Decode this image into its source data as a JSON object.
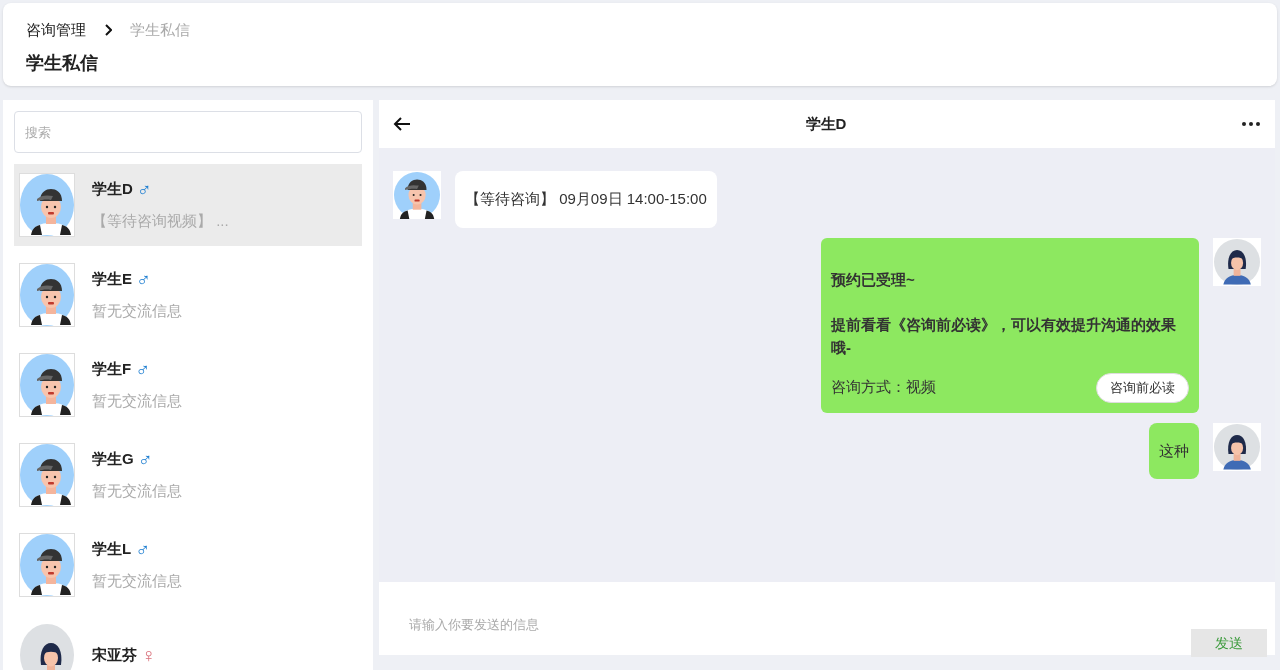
{
  "breadcrumb": [
    {
      "label": "咨询管理",
      "current": false
    },
    {
      "label": "学生私信",
      "current": true
    }
  ],
  "page_title": "学生私信",
  "search": {
    "placeholder": "搜索"
  },
  "contacts": [
    {
      "name": "学生D",
      "kind": "male",
      "symbol": "♂",
      "preview": "【等待咨询视频】 ...",
      "selected": true
    },
    {
      "name": "学生E",
      "kind": "male",
      "symbol": "♂",
      "preview": "暂无交流信息",
      "selected": false
    },
    {
      "name": "学生F",
      "kind": "male",
      "symbol": "♂",
      "preview": "暂无交流信息",
      "selected": false
    },
    {
      "name": "学生G",
      "kind": "male",
      "symbol": "♂",
      "preview": "暂无交流信息",
      "selected": false
    },
    {
      "name": "学生L",
      "kind": "male",
      "symbol": "♂",
      "preview": "暂无交流信息",
      "selected": false
    },
    {
      "name": "宋亚芬",
      "kind": "female",
      "symbol": "♀",
      "selected": false
    }
  ],
  "chat": {
    "title": "学生D",
    "messages": [
      {
        "kind": "incoming_text",
        "text": "【等待咨询】 09月09日 14:00-15:00"
      },
      {
        "kind": "outgoing_card",
        "lines": [
          "预约已受理~",
          "提前看看《咨询前必读》，可以有效提升沟通的效果哦-"
        ],
        "footer": "咨询方式：视频",
        "button": "咨询前必读"
      },
      {
        "kind": "outgoing_text",
        "text": "这种"
      }
    ],
    "input_placeholder": "请输入你要发送的信息",
    "send_button": "发送"
  }
}
